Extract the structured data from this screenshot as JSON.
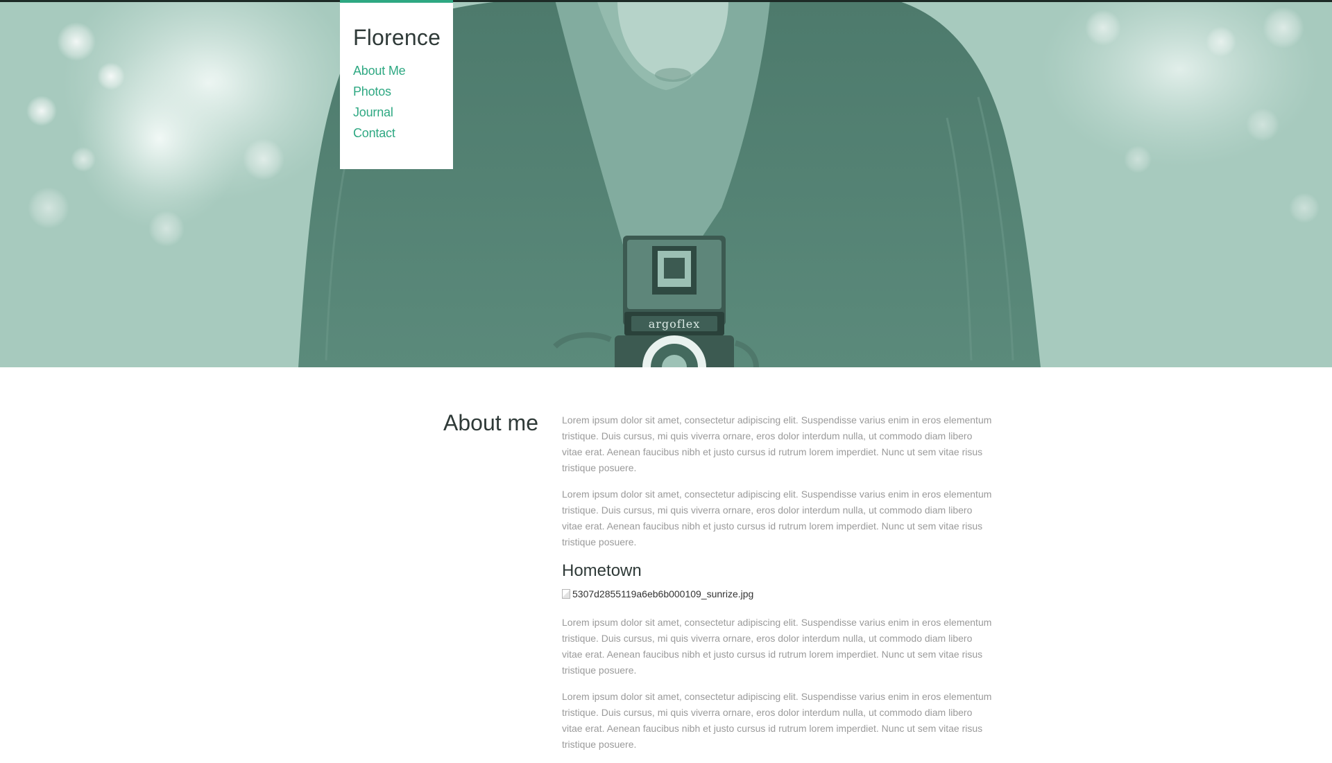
{
  "site": {
    "title": "Florence"
  },
  "nav": {
    "items": [
      {
        "label": "About Me"
      },
      {
        "label": "Photos"
      },
      {
        "label": "Journal"
      },
      {
        "label": "Contact"
      }
    ]
  },
  "hero": {
    "camera_brand": "argoflex"
  },
  "main": {
    "heading": "About me",
    "paragraphs_top": [
      "Lorem ipsum dolor sit amet, consectetur adipiscing elit. Suspendisse varius enim in eros elementum tristique. Duis cursus, mi quis viverra ornare, eros dolor interdum nulla, ut commodo diam libero vitae erat. Aenean faucibus nibh et justo cursus id rutrum lorem imperdiet. Nunc ut sem vitae risus tristique posuere.",
      "Lorem ipsum dolor sit amet, consectetur adipiscing elit. Suspendisse varius enim in eros elementum tristique. Duis cursus, mi quis viverra ornare, eros dolor interdum nulla, ut commodo diam libero vitae erat. Aenean faucibus nibh et justo cursus id rutrum lorem imperdiet. Nunc ut sem vitae risus tristique posuere."
    ],
    "subheading": "Hometown",
    "image_alt": "5307d2855119a6eb6b000109_sunrize.jpg",
    "paragraphs_bottom": [
      "Lorem ipsum dolor sit amet, consectetur adipiscing elit. Suspendisse varius enim in eros elementum tristique. Duis cursus, mi quis viverra ornare, eros dolor interdum nulla, ut commodo diam libero vitae erat. Aenean faucibus nibh et justo cursus id rutrum lorem imperdiet. Nunc ut sem vitae risus tristique posuere.",
      "Lorem ipsum dolor sit amet, consectetur adipiscing elit. Suspendisse varius enim in eros elementum tristique. Duis cursus, mi quis viverra ornare, eros dolor interdum nulla, ut commodo diam libero vitae erat. Aenean faucibus nibh et justo cursus id rutrum lorem imperdiet. Nunc ut sem vitae risus tristique posuere."
    ]
  },
  "colors": {
    "accent": "#2ea882",
    "hero_tint": "#a6c9bd",
    "heading_text": "#2f3a38",
    "body_text": "#9a9a9a"
  }
}
